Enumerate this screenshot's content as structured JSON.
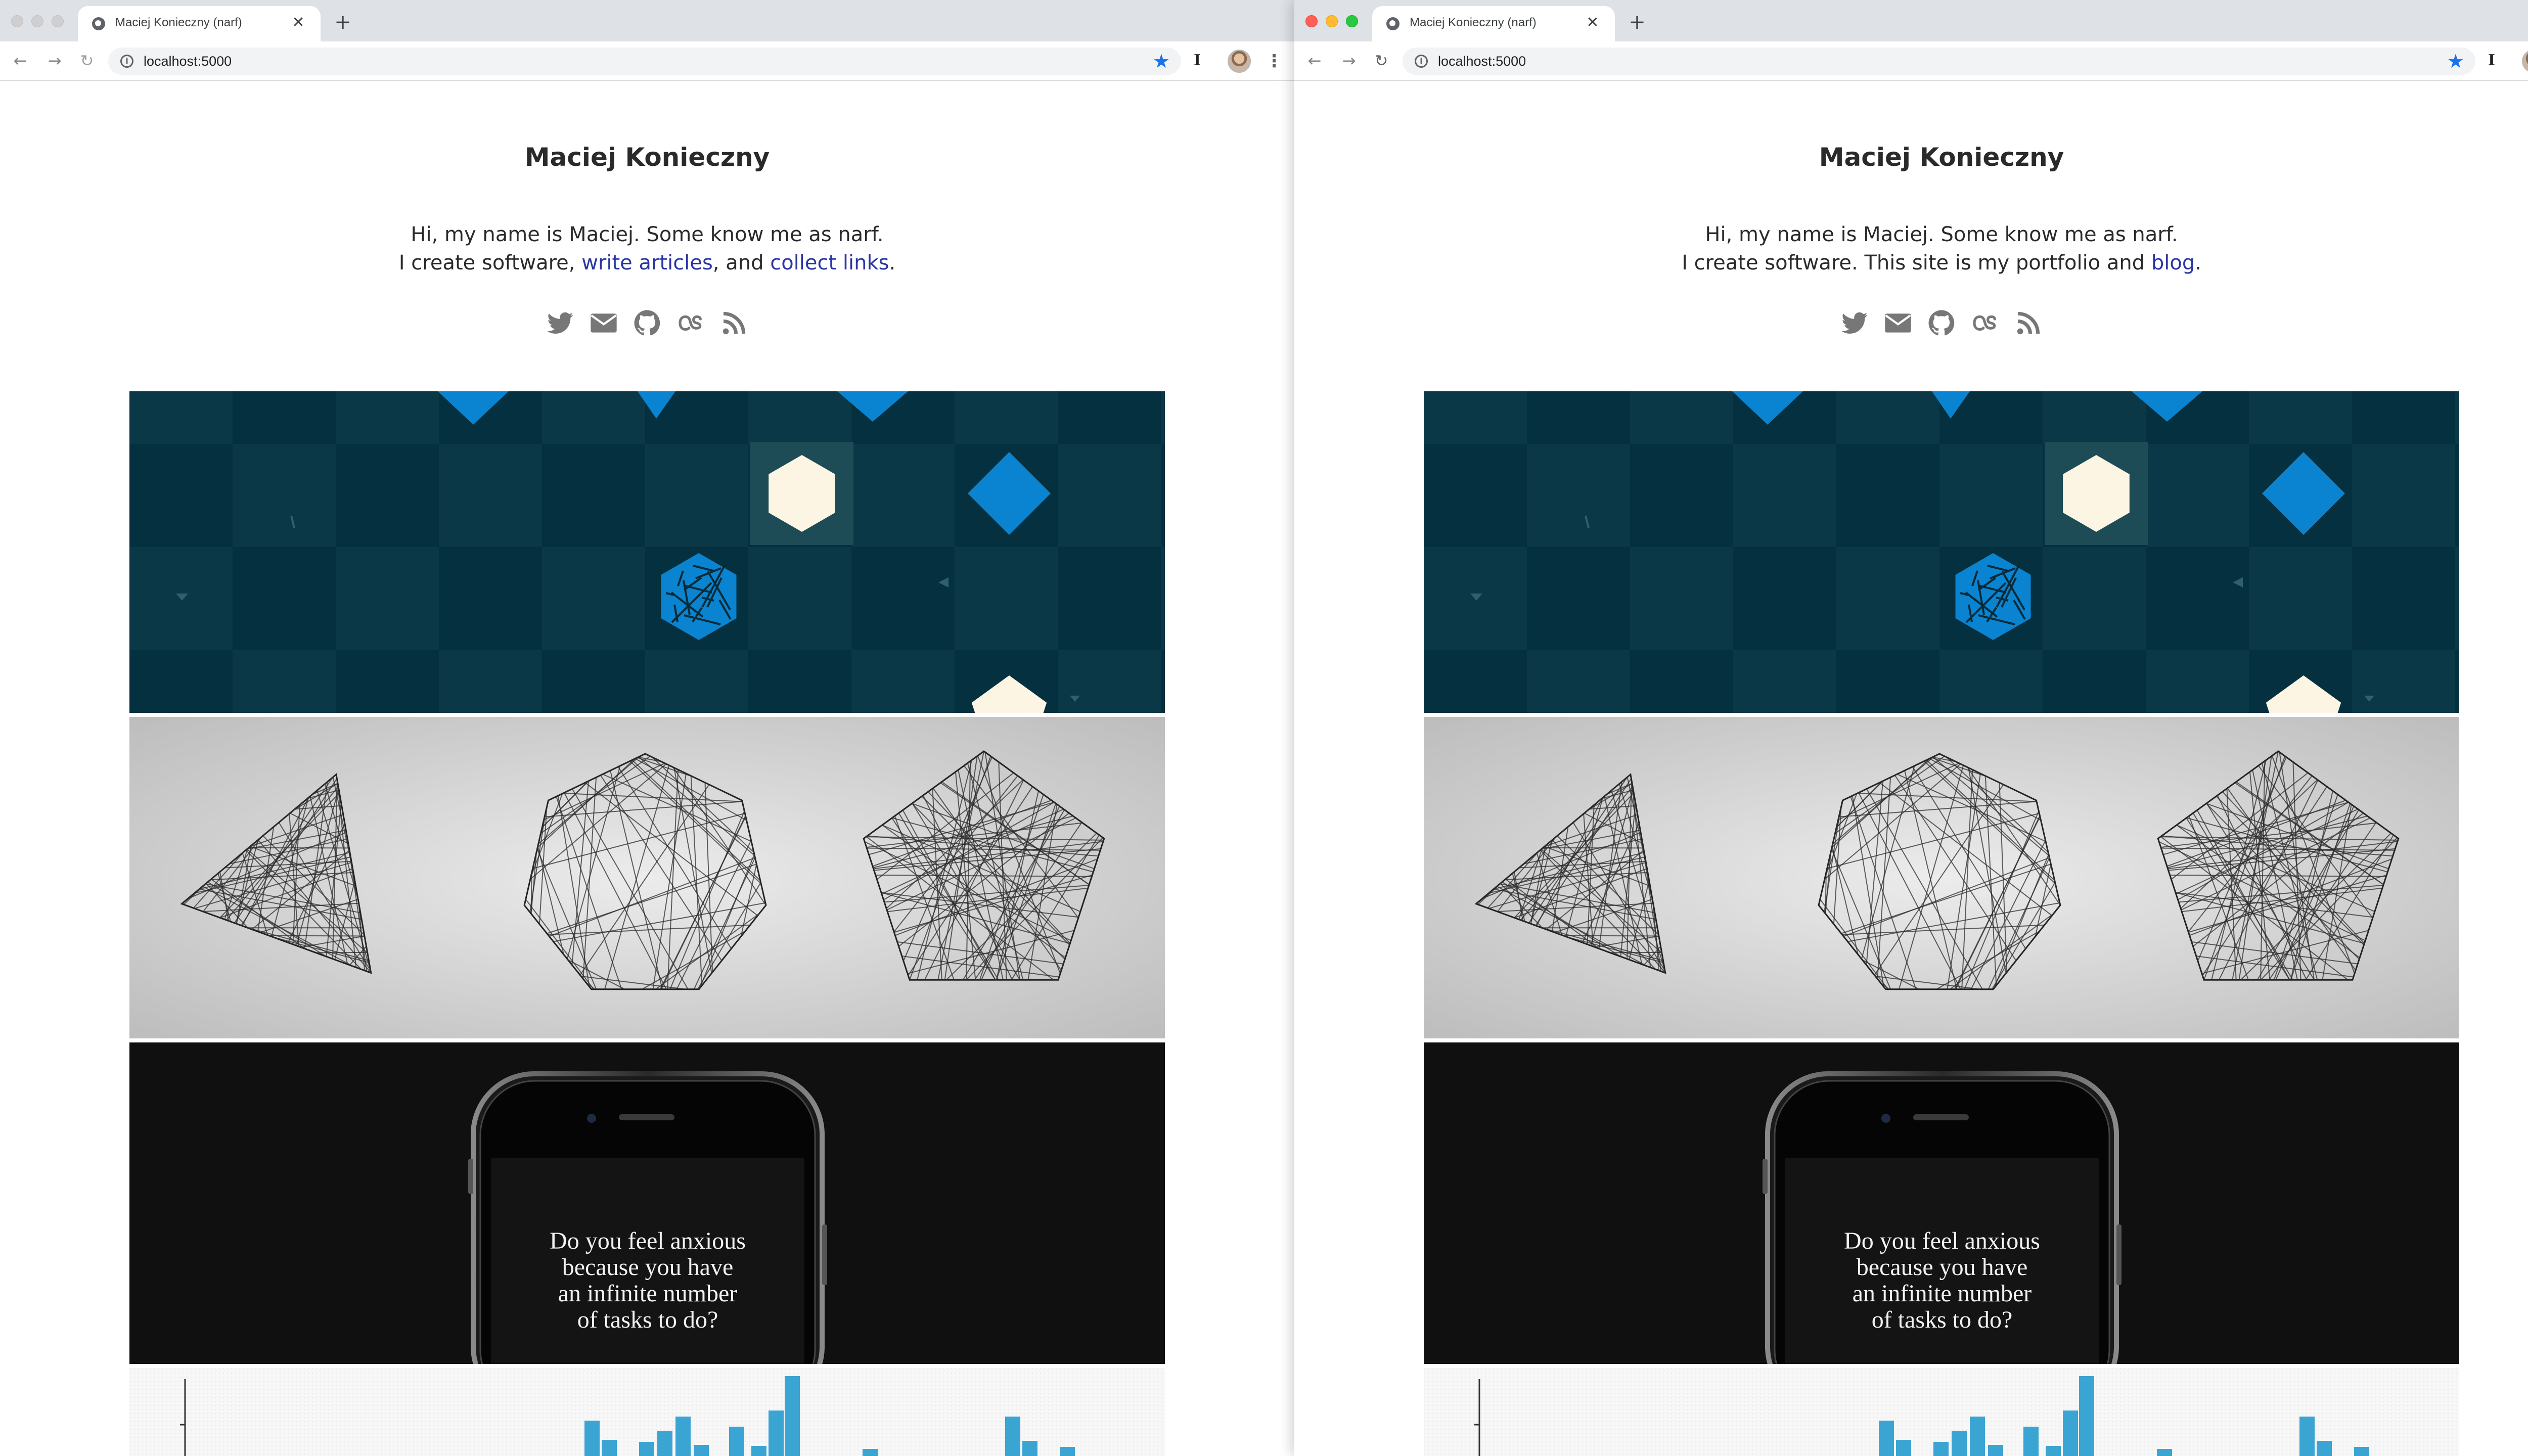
{
  "windows": [
    {
      "tab": {
        "title": "Maciej Konieczny (narf)",
        "close_glyph": "✕"
      },
      "new_tab_glyph": "+",
      "url": "localhost:5000",
      "site": {
        "title": "Maciej Konieczny",
        "intro_line1": "Hi, my name is Maciej. Some know me as narf.",
        "intro_prefix": "I create software, ",
        "link1": "write articles",
        "intro_mid": ", and ",
        "link2": "collect links",
        "intro_suffix": "."
      }
    },
    {
      "tab": {
        "title": "Maciej Konieczny (narf)",
        "close_glyph": "✕"
      },
      "new_tab_glyph": "+",
      "url": "localhost:5000",
      "site": {
        "title": "Maciej Konieczny",
        "intro_line1": "Hi, my name is Maciej. Some know me as narf.",
        "intro_prefix": "I create software. This site is my portfolio and ",
        "link1": "blog",
        "intro_suffix": "."
      }
    }
  ],
  "social_icons": [
    "twitter-icon",
    "email-icon",
    "github-icon",
    "lastfm-icon",
    "rss-icon"
  ],
  "projects": {
    "phone_text": [
      "Do you feel anxious",
      "because you have",
      "an infinite number",
      "of tasks to do?"
    ]
  },
  "colors": {
    "link": "#2a35a5",
    "text": "#2a2a2a",
    "game_bg": "#062b3a",
    "game_accent": "#0a84d0",
    "game_cream": "#fdf5e4",
    "chart_bar": "#3aa4d2"
  }
}
